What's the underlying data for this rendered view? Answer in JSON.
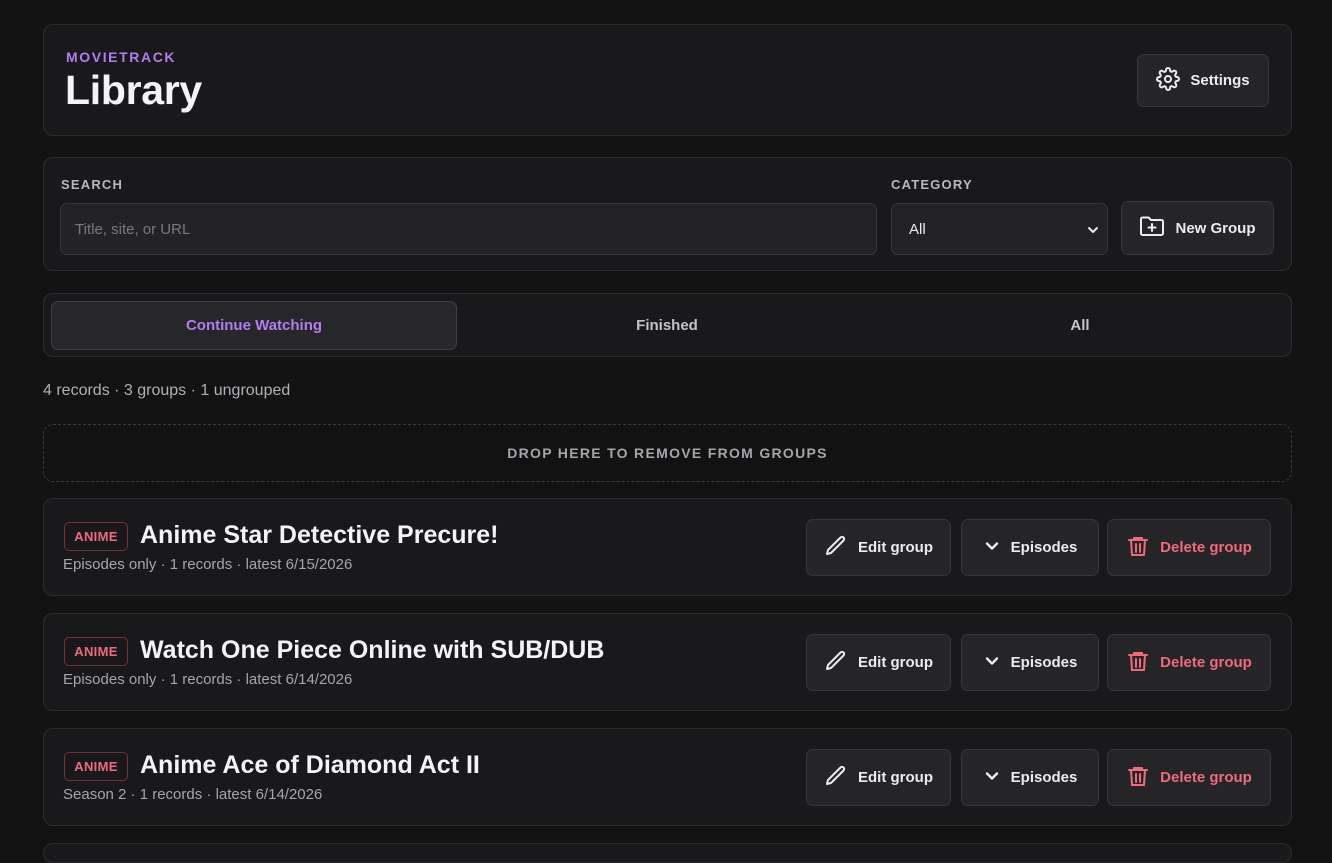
{
  "header": {
    "brand": "MOVIETRACK",
    "title": "Library",
    "settings_label": "Settings"
  },
  "filters": {
    "search_label": "SEARCH",
    "search_placeholder": "Title, site, or URL",
    "search_value": "",
    "category_label": "CATEGORY",
    "category_value": "All",
    "new_group_label": "New Group"
  },
  "tabs": [
    {
      "label": "Continue Watching",
      "active": true
    },
    {
      "label": "Finished",
      "active": false
    },
    {
      "label": "All",
      "active": false
    }
  ],
  "summary": "4 records · 3 groups · 1 ungrouped",
  "dropzone_label": "DROP HERE TO REMOVE FROM GROUPS",
  "groups": [
    {
      "badge": "ANIME",
      "title": "Anime Star Detective Precure!",
      "meta": "Episodes only · 1 records · latest 6/15/2026",
      "edit_label": "Edit group",
      "episodes_label": "Episodes",
      "delete_label": "Delete group"
    },
    {
      "badge": "ANIME",
      "title": "Watch One Piece Online with SUB/DUB",
      "meta": "Episodes only · 1 records · latest 6/14/2026",
      "edit_label": "Edit group",
      "episodes_label": "Episodes",
      "delete_label": "Delete group"
    },
    {
      "badge": "ANIME",
      "title": "Anime Ace of Diamond Act II",
      "meta": "Season 2 · 1 records · latest 6/14/2026",
      "edit_label": "Edit group",
      "episodes_label": "Episodes",
      "delete_label": "Delete group"
    }
  ],
  "colors": {
    "accent": "#b57cf0",
    "danger": "#f06a7e",
    "background": "#121213",
    "card": "#19191b"
  },
  "icons": {
    "settings": "gear-icon",
    "new_group": "folder-plus-icon",
    "edit": "pencil-icon",
    "episodes": "chevron-down-icon",
    "delete": "trash-icon"
  }
}
